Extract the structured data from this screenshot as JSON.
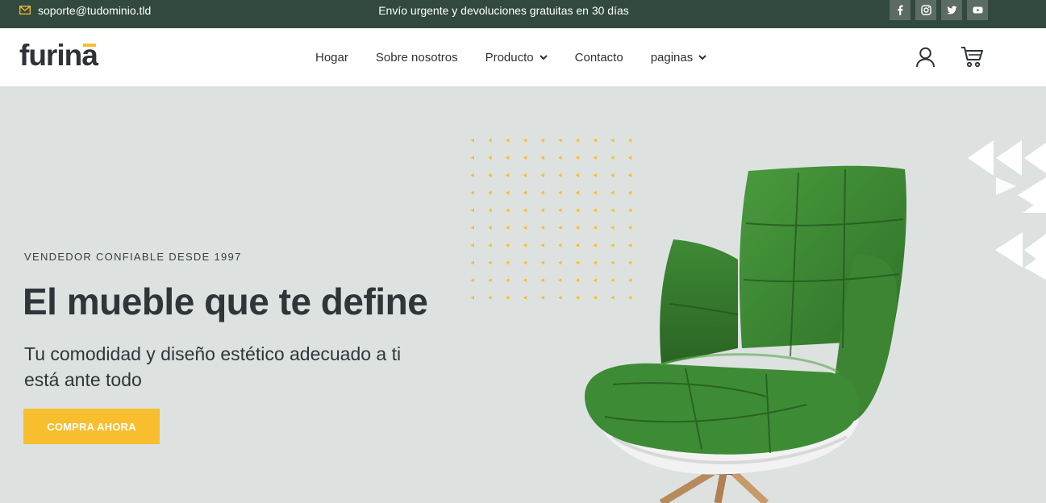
{
  "topbar": {
    "email": "soporte@tudominio.tld",
    "email_icon": "mail-icon",
    "promo": "Envío urgente y devoluciones gratuitas en 30 días",
    "socials": [
      "facebook-icon",
      "instagram-icon",
      "twitter-icon",
      "youtube-icon"
    ]
  },
  "header": {
    "logo": "furinā",
    "nav": [
      {
        "label": "Hogar"
      },
      {
        "label": "Sobre nosotros"
      },
      {
        "label": "Producto",
        "icon": "chevron-down-icon"
      },
      {
        "label": "Contacto"
      },
      {
        "label": "paginas",
        "icon": "chevron-down-icon"
      }
    ],
    "icons": [
      "user-icon",
      "cart-icon"
    ]
  },
  "hero": {
    "eyebrow": "VENDEDOR CONFIABLE DESDE 1997",
    "headline": "El mueble que te define",
    "subhead": "Tu comodidad y diseño estético adecuado a ti está ante todo",
    "cta": "COMPRA AHORA",
    "image": "green-lounge-chair"
  },
  "colors": {
    "topbar_bg": "#324a3e",
    "accent": "#f8be2e",
    "hero_bg": "#dde2e0",
    "text_dark": "#2f3539",
    "chair_green": "#3f8a35"
  }
}
